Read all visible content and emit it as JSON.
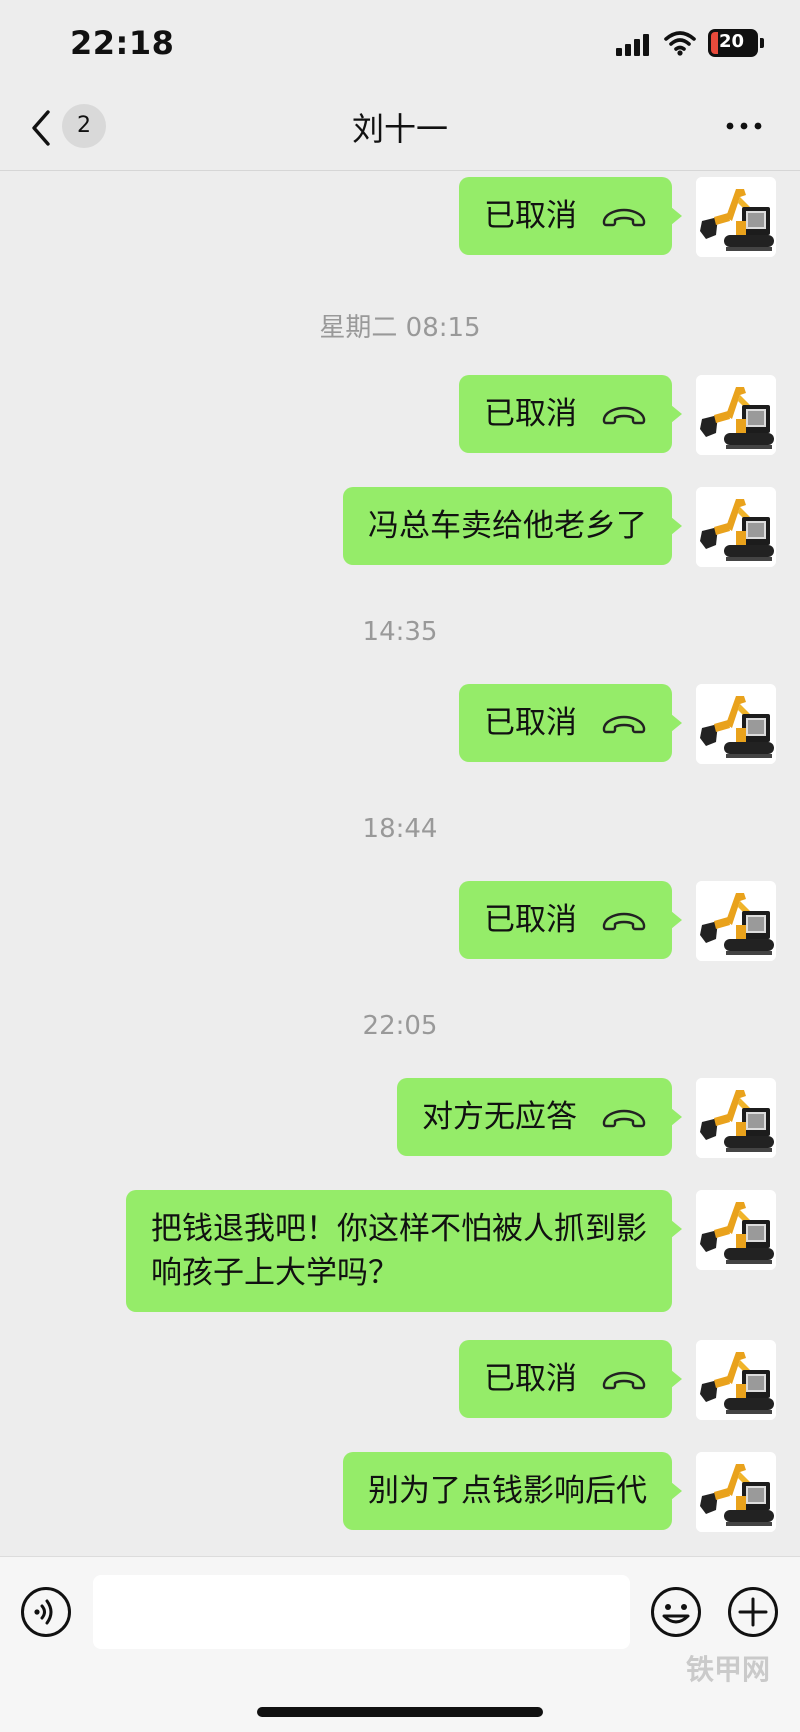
{
  "status_bar": {
    "time": "22:18",
    "battery": "20"
  },
  "nav": {
    "unread_count": "2",
    "title": "刘十一"
  },
  "messages": [
    {
      "type": "call",
      "text": "已取消"
    },
    {
      "type": "time",
      "text": "星期二 08:15"
    },
    {
      "type": "call",
      "text": "已取消"
    },
    {
      "type": "text",
      "text": "冯总车卖给他老乡了"
    },
    {
      "type": "time",
      "text": "14:35"
    },
    {
      "type": "call",
      "text": "已取消"
    },
    {
      "type": "time",
      "text": "18:44"
    },
    {
      "type": "call",
      "text": "已取消"
    },
    {
      "type": "time",
      "text": "22:05"
    },
    {
      "type": "call",
      "text": "对方无应答"
    },
    {
      "type": "text",
      "text": "把钱退我吧！你这样不怕被人抓到影响孩子上大学吗？"
    },
    {
      "type": "call",
      "text": "已取消"
    },
    {
      "type": "text",
      "text": "别为了点钱影响后代"
    }
  ],
  "input": {
    "value": "",
    "placeholder": ""
  },
  "watermark": "铁甲网",
  "colors": {
    "bubble": "#95ec69",
    "background": "#ededed",
    "battery_low": "#e84a3b"
  },
  "icons": [
    "back-icon",
    "more-icon",
    "call-icon",
    "voice-icon",
    "emoji-icon",
    "plus-icon"
  ]
}
